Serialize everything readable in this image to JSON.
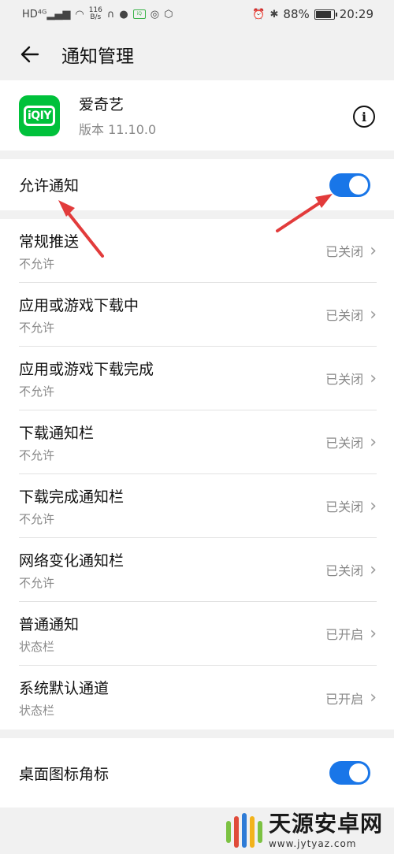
{
  "status_bar": {
    "net_speed_top": "116",
    "net_speed_bottom": "B/s",
    "battery": "88%",
    "time": "20:29"
  },
  "header": {
    "title": "通知管理"
  },
  "app": {
    "name": "爱奇艺",
    "version": "版本 11.10.0",
    "logo_text": "iQIY"
  },
  "allow": {
    "label": "允许通知",
    "enabled": true
  },
  "channels": [
    {
      "title": "常规推送",
      "sub": "不允许",
      "status": "已关闭"
    },
    {
      "title": "应用或游戏下载中",
      "sub": "不允许",
      "status": "已关闭"
    },
    {
      "title": "应用或游戏下载完成",
      "sub": "不允许",
      "status": "已关闭"
    },
    {
      "title": "下载通知栏",
      "sub": "不允许",
      "status": "已关闭"
    },
    {
      "title": "下载完成通知栏",
      "sub": "不允许",
      "status": "已关闭"
    },
    {
      "title": "网络变化通知栏",
      "sub": "不允许",
      "status": "已关闭"
    },
    {
      "title": "普通通知",
      "sub": "状态栏",
      "status": "已开启"
    },
    {
      "title": "系统默认通道",
      "sub": "状态栏",
      "status": "已开启"
    }
  ],
  "badge": {
    "label": "桌面图标角标",
    "enabled": true
  },
  "watermark": {
    "title": "天源安卓网",
    "url": "www.jytyaz.com"
  },
  "colors": {
    "toggle_on": "#1976e8",
    "app_brand": "#00c13b",
    "annotation": "#e23b3b"
  }
}
